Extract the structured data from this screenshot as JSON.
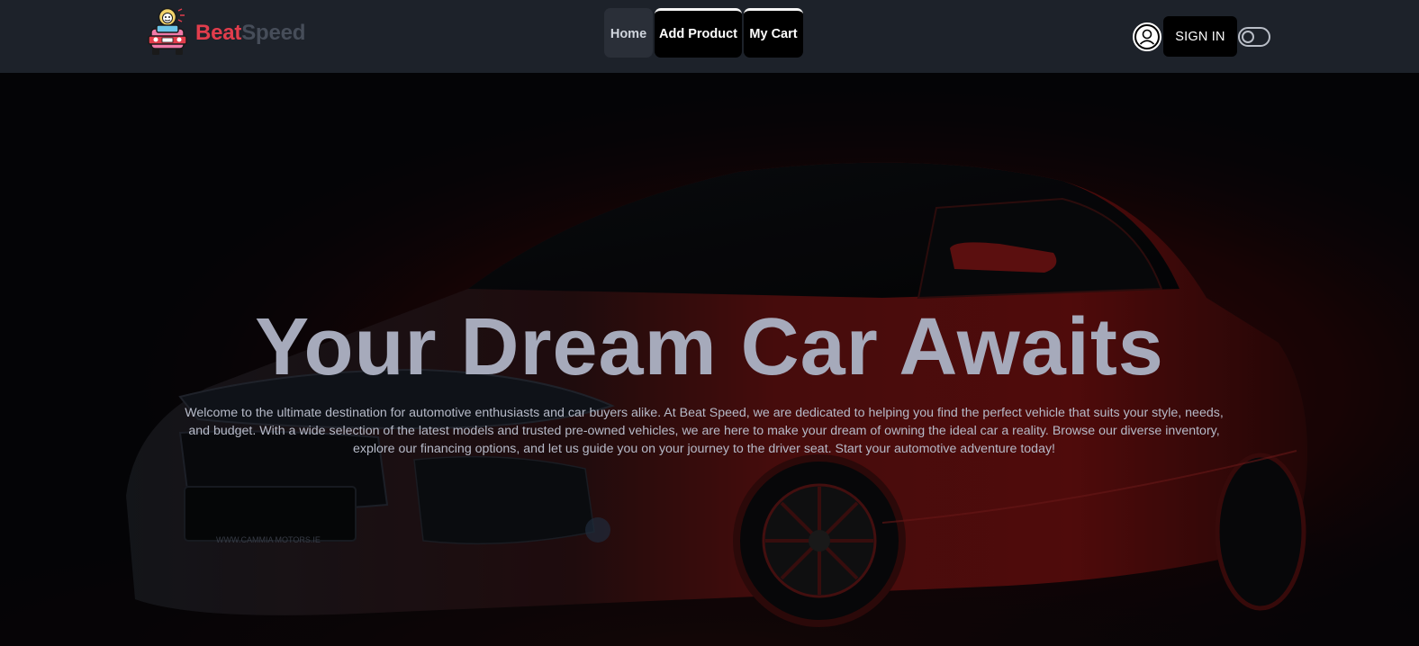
{
  "brand": {
    "name_part1": "Beat",
    "name_part2": "Speed",
    "logo_icon": "car-mascot-logo"
  },
  "nav": {
    "tabs": [
      {
        "label": "Home",
        "active": true
      },
      {
        "label": "Add Product",
        "active": false
      },
      {
        "label": "My Cart",
        "active": false
      }
    ]
  },
  "header": {
    "avatar_icon": "user-avatar-icon",
    "signin_label": "SIGN IN",
    "theme_toggle_icon": "toggle-icon"
  },
  "hero": {
    "title": "Your Dream Car Awaits",
    "description": "Welcome to the ultimate destination for automotive enthusiasts and car buyers alike. At Beat Speed, we are dedicated to helping you find the perfect vehicle that suits your style, needs, and budget. With a wide selection of the latest models and trusted pre-owned vehicles, we are here to make your dream of owning the ideal car a reality. Browse our diverse inventory, explore our financing options, and let us guide you on your journey to the driver seat. Start your automotive adventure today!",
    "plate_text": "WWW.CAMMIA MOTORS.IE"
  },
  "colors": {
    "navbar_bg": "#1d222a",
    "brand_accent": "#e23d4c",
    "brand_muted": "#464d59",
    "hero_title": "#a6aabb",
    "car_red": "#8a1414"
  }
}
